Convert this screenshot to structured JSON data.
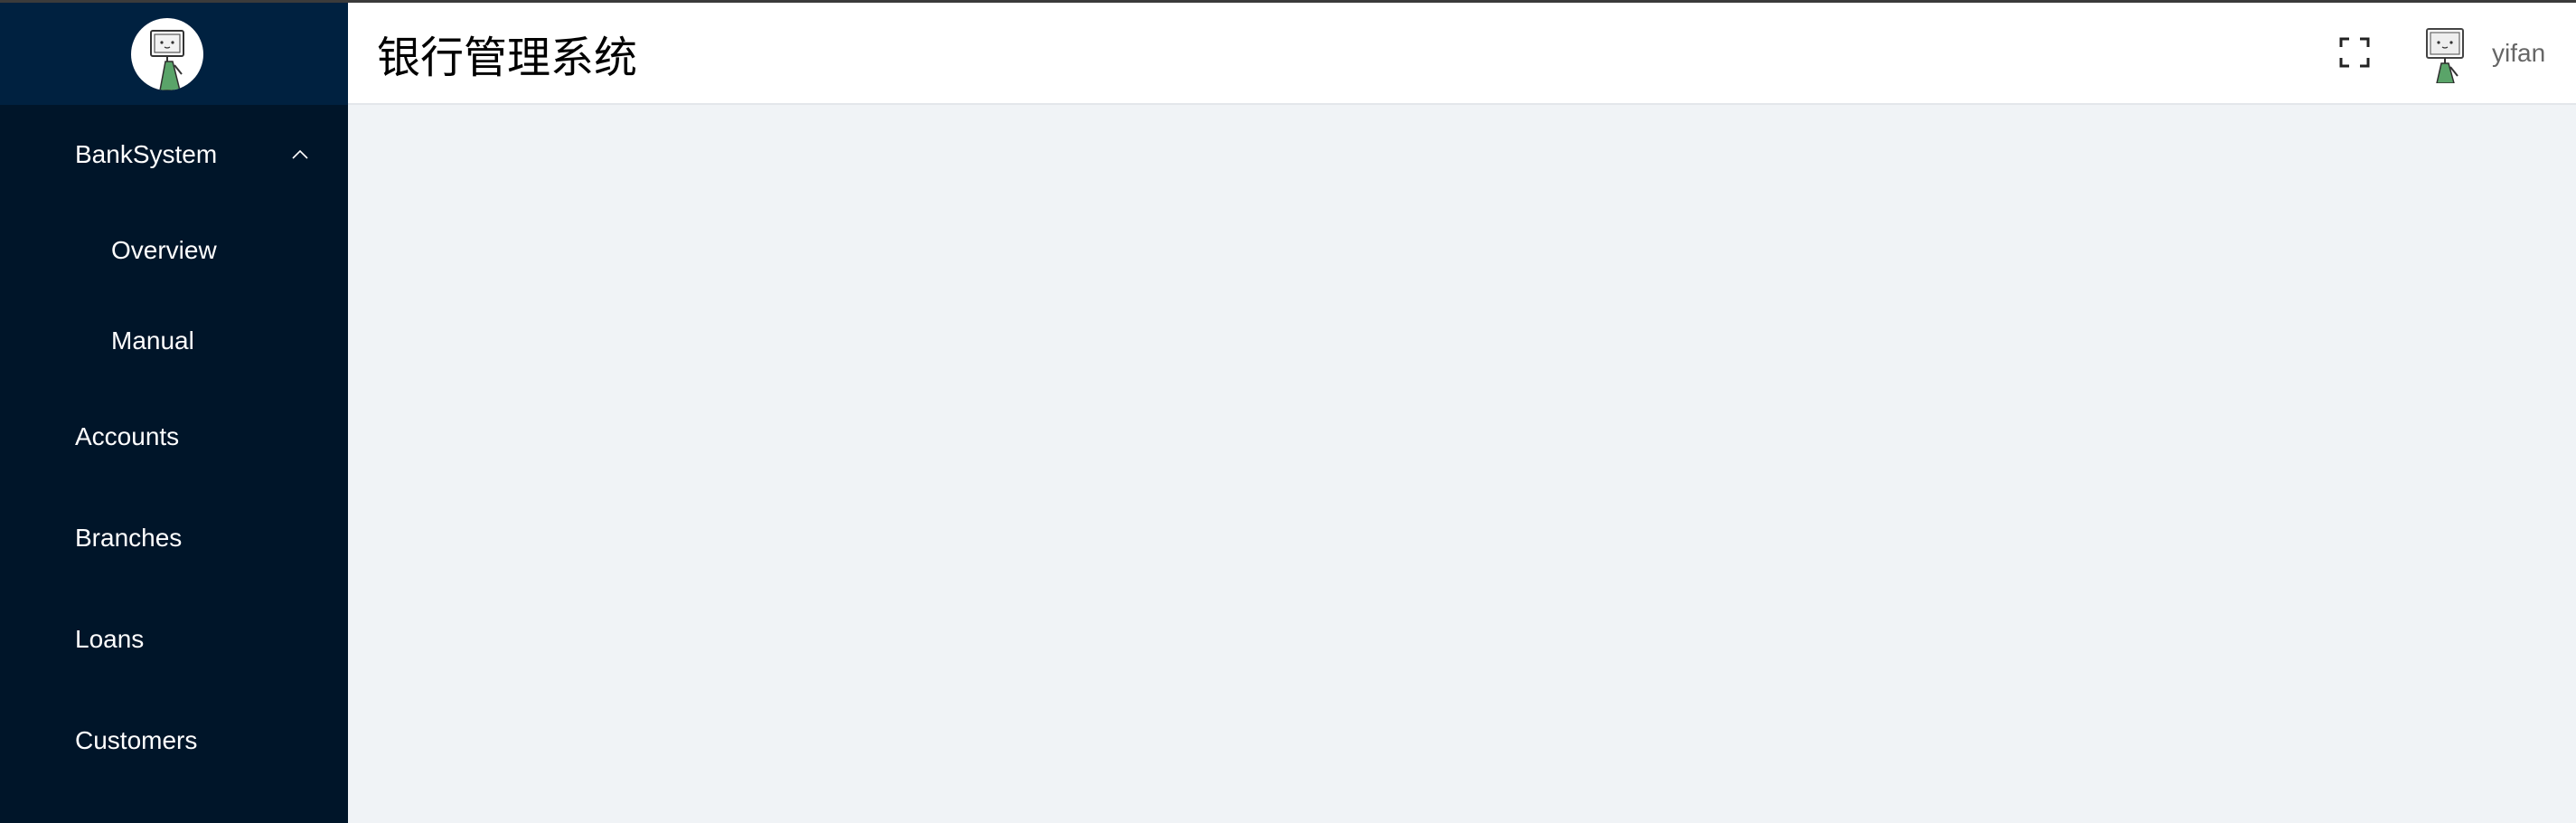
{
  "header": {
    "title": "银行管理系统",
    "username": "yifan"
  },
  "sidebar": {
    "items": [
      {
        "label": "BankSystem",
        "expanded": true
      },
      {
        "label": "Overview"
      },
      {
        "label": "Manual"
      },
      {
        "label": "Accounts"
      },
      {
        "label": "Branches"
      },
      {
        "label": "Loans"
      },
      {
        "label": "Customers"
      }
    ]
  },
  "icons": {
    "logo": "robot-avatar-icon",
    "expand": "chevron-up-icon",
    "fullscreen": "fullscreen-icon",
    "user_avatar": "robot-avatar-icon"
  },
  "colors": {
    "sidebar_bg": "#001529",
    "logo_bg": "#002140",
    "content_bg": "#f0f3f6",
    "header_bg": "#ffffff",
    "avatar_accent": "#5aa469"
  }
}
